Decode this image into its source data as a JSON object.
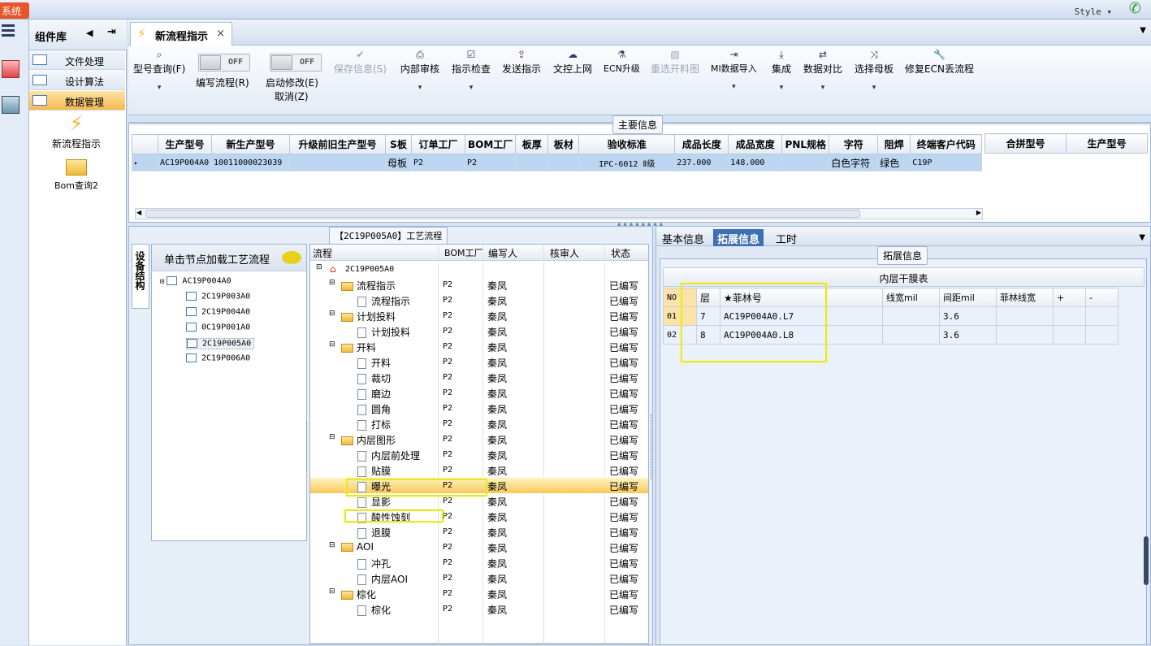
{
  "topbar": {
    "sys_label": "系统",
    "style_label": "Style ▾"
  },
  "component_library": {
    "title": "组件库",
    "items": [
      {
        "label": "文件处理",
        "active": false
      },
      {
        "label": "设计算法",
        "active": false
      },
      {
        "label": "数据管理",
        "active": true
      }
    ],
    "tools": [
      {
        "label": "新流程指示",
        "icon": "lightning-icon"
      },
      {
        "label": "Bom查询2",
        "icon": "folder-open-icon"
      }
    ]
  },
  "tab": {
    "title": "新流程指示",
    "close": "×"
  },
  "toolbar": {
    "buttons": [
      {
        "label": "型号查询(F)",
        "glyph": "🔍",
        "disabled": false,
        "dropdown": true
      },
      {
        "label": "编写流程(R)",
        "toggle": "OFF"
      },
      {
        "label": "启动修改(E)",
        "sub": "取消(Z)",
        "toggle": "OFF"
      },
      {
        "label": "保存信息(S)",
        "glyph": "✔",
        "disabled": true
      },
      {
        "label": "内部审核",
        "glyph": "🖶",
        "dropdown": true
      },
      {
        "label": "指示检查",
        "glyph": "☑",
        "dropdown": true
      },
      {
        "label": "发送指示",
        "glyph": "⇪"
      },
      {
        "label": "文控上网",
        "glyph": "☁"
      },
      {
        "label": "ECN升级",
        "glyph": "⚗"
      },
      {
        "label": "重选开料图",
        "glyph": "▧",
        "disabled": true
      },
      {
        "label": "MI数据导入",
        "glyph": "⇥",
        "dropdown": true
      },
      {
        "label": "集成",
        "glyph": "⤓",
        "dropdown": true
      },
      {
        "label": "数据对比",
        "glyph": "⇄",
        "dropdown": true
      },
      {
        "label": "选择母板",
        "glyph": "⤨",
        "dropdown": true
      },
      {
        "label": "修复ECN丢流程",
        "glyph": "🔧"
      }
    ]
  },
  "main_info": {
    "title": "主要信息",
    "columns": [
      "生产型号",
      "新生产型号",
      "升级前旧生产型号",
      "S板",
      "订单工厂",
      "BOM工厂",
      "板厚",
      "板材",
      "验收标准",
      "成品长度",
      "成品宽度",
      "PNL规格",
      "字符",
      "阻焊",
      "终端客户代码"
    ],
    "rows": [
      [
        "AC19P004A0",
        "10011000023039",
        "",
        "母板",
        "P2",
        "P2",
        "",
        "",
        "IPC-6012 Ⅱ级",
        "237.000",
        "148.000",
        "",
        "白色字符",
        "绿色",
        "C19P"
      ]
    ],
    "side_columns": [
      "合拼型号",
      "生产型号"
    ]
  },
  "workflow": {
    "title": "【2C19P005A0】工艺流程",
    "vertical_tab": "设备结构",
    "left_header": "单击节点加载工艺流程",
    "tree_root": "AC19P004A0",
    "tree_children": [
      "2C19P003A0",
      "2C19P004A0",
      "0C19P001A0",
      "2C19P005A0",
      "2C19P006A0"
    ],
    "flow_columns": [
      "流程",
      "BOM工厂",
      "编写人",
      "核审人",
      "状态"
    ],
    "flow_root": "2C19P005A0",
    "flow_rows": [
      {
        "name": "流程指示",
        "level": 1,
        "folder": true,
        "factory": "P2",
        "writer": "秦凤",
        "reviewer": "",
        "status": "已编写"
      },
      {
        "name": "流程指示",
        "level": 2,
        "folder": false,
        "factory": "P2",
        "writer": "秦凤",
        "reviewer": "",
        "status": "已编写"
      },
      {
        "name": "计划投料",
        "level": 1,
        "folder": true,
        "factory": "P2",
        "writer": "秦凤",
        "reviewer": "",
        "status": "已编写"
      },
      {
        "name": "计划投料",
        "level": 2,
        "folder": false,
        "factory": "P2",
        "writer": "秦凤",
        "reviewer": "",
        "status": "已编写"
      },
      {
        "name": "开料",
        "level": 1,
        "folder": true,
        "factory": "P2",
        "writer": "秦凤",
        "reviewer": "",
        "status": "已编写"
      },
      {
        "name": "开料",
        "level": 2,
        "folder": false,
        "factory": "P2",
        "writer": "秦凤",
        "reviewer": "",
        "status": "已编写"
      },
      {
        "name": "裁切",
        "level": 2,
        "folder": false,
        "factory": "P2",
        "writer": "秦凤",
        "reviewer": "",
        "status": "已编写"
      },
      {
        "name": "磨边",
        "level": 2,
        "folder": false,
        "factory": "P2",
        "writer": "秦凤",
        "reviewer": "",
        "status": "已编写"
      },
      {
        "name": "圆角",
        "level": 2,
        "folder": false,
        "factory": "P2",
        "writer": "秦凤",
        "reviewer": "",
        "status": "已编写"
      },
      {
        "name": "打标",
        "level": 2,
        "folder": false,
        "factory": "P2",
        "writer": "秦凤",
        "reviewer": "",
        "status": "已编写"
      },
      {
        "name": "内层图形",
        "level": 1,
        "folder": true,
        "factory": "P2",
        "writer": "秦凤",
        "reviewer": "",
        "status": "已编写"
      },
      {
        "name": "内层前处理",
        "level": 2,
        "folder": false,
        "factory": "P2",
        "writer": "秦凤",
        "reviewer": "",
        "status": "已编写"
      },
      {
        "name": "贴膜",
        "level": 2,
        "folder": false,
        "factory": "P2",
        "writer": "秦凤",
        "reviewer": "",
        "status": "已编写"
      },
      {
        "name": "曝光",
        "level": 2,
        "folder": false,
        "factory": "P2",
        "writer": "秦凤",
        "reviewer": "",
        "status": "已编写",
        "selected": true
      },
      {
        "name": "显影",
        "level": 2,
        "folder": false,
        "factory": "P2",
        "writer": "秦凤",
        "reviewer": "",
        "status": "已编写"
      },
      {
        "name": "酸性蚀刻",
        "level": 2,
        "folder": false,
        "factory": "P2",
        "writer": "秦凤",
        "reviewer": "",
        "status": "已编写"
      },
      {
        "name": "退膜",
        "level": 2,
        "folder": false,
        "factory": "P2",
        "writer": "秦凤",
        "reviewer": "",
        "status": "已编写"
      },
      {
        "name": "AOI",
        "level": 1,
        "folder": true,
        "factory": "P2",
        "writer": "秦凤",
        "reviewer": "",
        "status": "已编写"
      },
      {
        "name": "冲孔",
        "level": 2,
        "folder": false,
        "factory": "P2",
        "writer": "秦凤",
        "reviewer": "",
        "status": "已编写"
      },
      {
        "name": "内层AOI",
        "level": 2,
        "folder": false,
        "factory": "P2",
        "writer": "秦凤",
        "reviewer": "",
        "status": "已编写"
      },
      {
        "name": "棕化",
        "level": 1,
        "folder": true,
        "factory": "P2",
        "writer": "秦凤",
        "reviewer": "",
        "status": "已编写"
      },
      {
        "name": "棕化",
        "level": 2,
        "folder": false,
        "factory": "P2",
        "writer": "秦凤",
        "reviewer": "",
        "status": "已编写"
      }
    ]
  },
  "right_panel": {
    "tabs": [
      "基本信息",
      "拓展信息",
      "工时"
    ],
    "active_tab": 1,
    "section_title": "拓展信息",
    "table_title": "内层干膜表",
    "columns": [
      "NO",
      "层",
      "★菲林号",
      "线宽mil",
      "间距mil",
      "菲林线宽",
      "+",
      "-"
    ],
    "rows": [
      [
        "01",
        "7",
        "AC19P004A0.L7",
        "",
        "3.6",
        "",
        "",
        ""
      ],
      [
        "02",
        "8",
        "AC19P004A0.L8",
        "",
        "3.6",
        "",
        "",
        ""
      ]
    ]
  },
  "colors": {
    "accent": "#3d6fb2",
    "selection": "#f7b94e",
    "highlight_box": "#e8e81c",
    "sys_tab": "#e8552a"
  }
}
